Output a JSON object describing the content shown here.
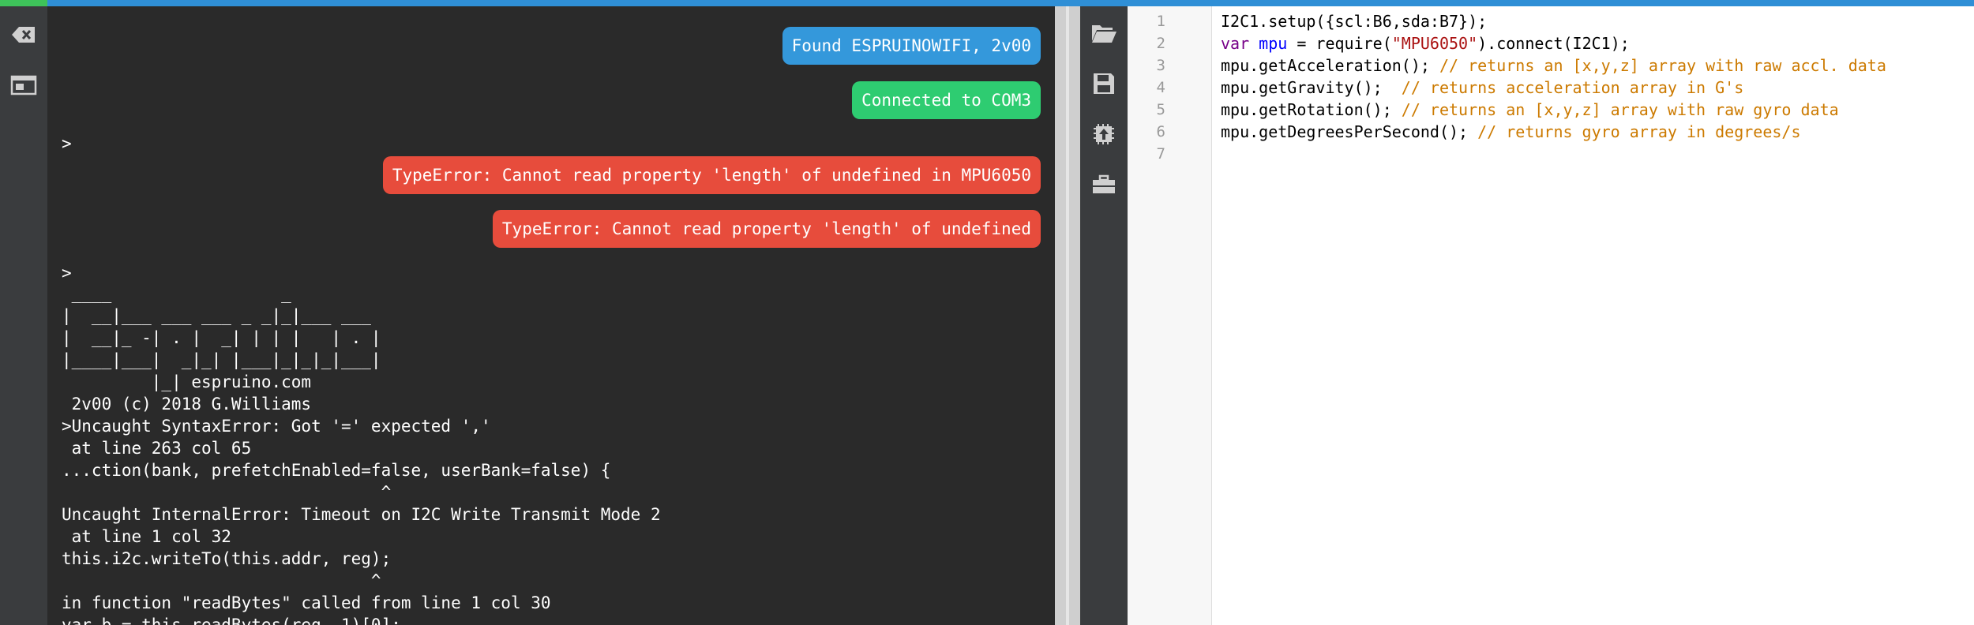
{
  "terminal": {
    "notifications": [
      {
        "text": "Found ESPRUINOWIFI, 2v00",
        "kind": "info",
        "color": "#3498db"
      },
      {
        "text": "Connected to COM3",
        "kind": "success",
        "color": "#2ecc71"
      },
      {
        "text": "TypeError: Cannot read property 'length' of undefined in MPU6050",
        "kind": "error",
        "color": "#e74c3c"
      },
      {
        "text": "TypeError: Cannot read property 'length' of undefined",
        "kind": "error",
        "color": "#e74c3c"
      }
    ],
    "prompt_1": ">",
    "prompt_2": ">",
    "output_lines": [
      " ____                 _",
      "|  __|___ ___ ___ _ _|_|___ ___",
      "|  __|_ -| . |  _| | | |   | . |",
      "|____|___|  _|_| |___|_|_|_|___|",
      "         |_| espruino.com",
      " 2v00 (c) 2018 G.Williams",
      ">Uncaught SyntaxError: Got '=' expected ','",
      " at line 263 col 65",
      "...ction(bank, prefetchEnabled=false, userBank=false) {",
      "                                ^",
      "Uncaught InternalError: Timeout on I2C Write Transmit Mode 2",
      " at line 1 col 32",
      "this.i2c.writeTo(this.addr, reg);",
      "                               ^",
      "in function \"readBytes\" called from line 1 col 30",
      "var b = this.readBytes(reg, 1)[0];"
    ]
  },
  "left_toolbar": {
    "icons": [
      "clear-terminal-icon",
      "screen-layout-icon"
    ]
  },
  "right_toolbar": {
    "icons": [
      "open-folder-icon",
      "save-icon",
      "send-to-device-icon",
      "toolbox-icon"
    ]
  },
  "editor": {
    "lines": [
      {
        "num": "1",
        "tokens": [
          {
            "t": "I2C1.setup({scl:B6,sda:B7});",
            "k": "plain"
          }
        ]
      },
      {
        "num": "2",
        "tokens": [
          {
            "t": "var",
            "k": "keyword"
          },
          {
            "t": " ",
            "k": "plain"
          },
          {
            "t": "mpu",
            "k": "variable"
          },
          {
            "t": " = require(",
            "k": "plain"
          },
          {
            "t": "\"MPU6050\"",
            "k": "string"
          },
          {
            "t": ").connect(I2C1);",
            "k": "plain"
          }
        ]
      },
      {
        "num": "3",
        "tokens": [
          {
            "t": "mpu.getAcceleration(); ",
            "k": "plain"
          },
          {
            "t": "// returns an [x,y,z] array with raw accl. data",
            "k": "comment"
          }
        ]
      },
      {
        "num": "4",
        "tokens": [
          {
            "t": "mpu.getGravity();  ",
            "k": "plain"
          },
          {
            "t": "// returns acceleration array in G's",
            "k": "comment"
          }
        ]
      },
      {
        "num": "5",
        "tokens": [
          {
            "t": "mpu.getRotation(); ",
            "k": "plain"
          },
          {
            "t": "// returns an [x,y,z] array with raw gyro data",
            "k": "comment"
          }
        ]
      },
      {
        "num": "6",
        "tokens": [
          {
            "t": "mpu.getDegreesPerSecond(); ",
            "k": "plain"
          },
          {
            "t": "// returns gyro array in degrees/s",
            "k": "comment"
          }
        ]
      },
      {
        "num": "7",
        "tokens": []
      }
    ]
  },
  "colors": {
    "accent": "#2f8fd6",
    "connected": "#3ec35a",
    "terminal_bg": "#2a2a2a",
    "toolbar_bg": "#3a3c3e"
  }
}
